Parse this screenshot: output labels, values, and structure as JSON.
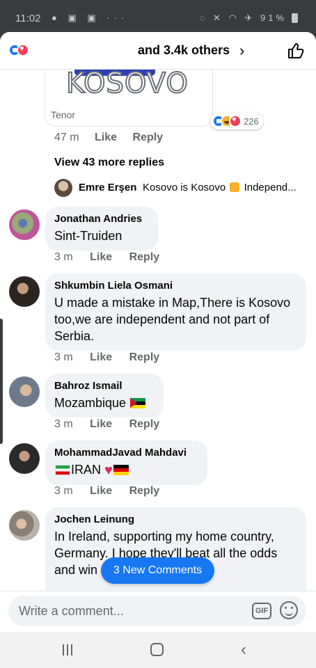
{
  "status_bar": {
    "time": "11:02",
    "battery": "91%"
  },
  "header": {
    "title": "and 3.4k others",
    "chevron": "›",
    "like_icon": "thumbs-up-outline-icon"
  },
  "gif_comment": {
    "gif_text": "KOSOVO",
    "provider": "Tenor",
    "reaction_count": "226",
    "time": "47 m",
    "like_label": "Like",
    "reply_label": "Reply",
    "view_more_replies": "View 43 more replies",
    "preview_reply": {
      "author": "Emre Erşen",
      "text_before": "Kosovo is Kosovo",
      "text_after": "Independ..."
    }
  },
  "comments": [
    {
      "author": "Jonathan Andries",
      "text": "Sint-Truiden",
      "time": "3 m",
      "like_label": "Like",
      "reply_label": "Reply"
    },
    {
      "author": "Shkumbin Liela Osmani",
      "text": "U made a mistake in Map,There is Kosovo too,we are independent and not part of Serbia.",
      "time": "3 m",
      "like_label": "Like",
      "reply_label": "Reply"
    },
    {
      "author": "Bahroz Ismail",
      "text": "Mozambique",
      "time": "3 m",
      "like_label": "Like",
      "reply_label": "Reply"
    },
    {
      "author": "MohammadJavad Mahdavi",
      "text": "IRAN",
      "time": "3 m",
      "like_label": "Like",
      "reply_label": "Reply"
    },
    {
      "author": "Jochen Leinung",
      "text": "In Ireland, supporting my home country, Germany. I hope they'll beat all the odds and win"
    }
  ],
  "new_comments_pill": "3 New Comments",
  "composer": {
    "placeholder": "Write a comment...",
    "gif_label": "GIF"
  }
}
